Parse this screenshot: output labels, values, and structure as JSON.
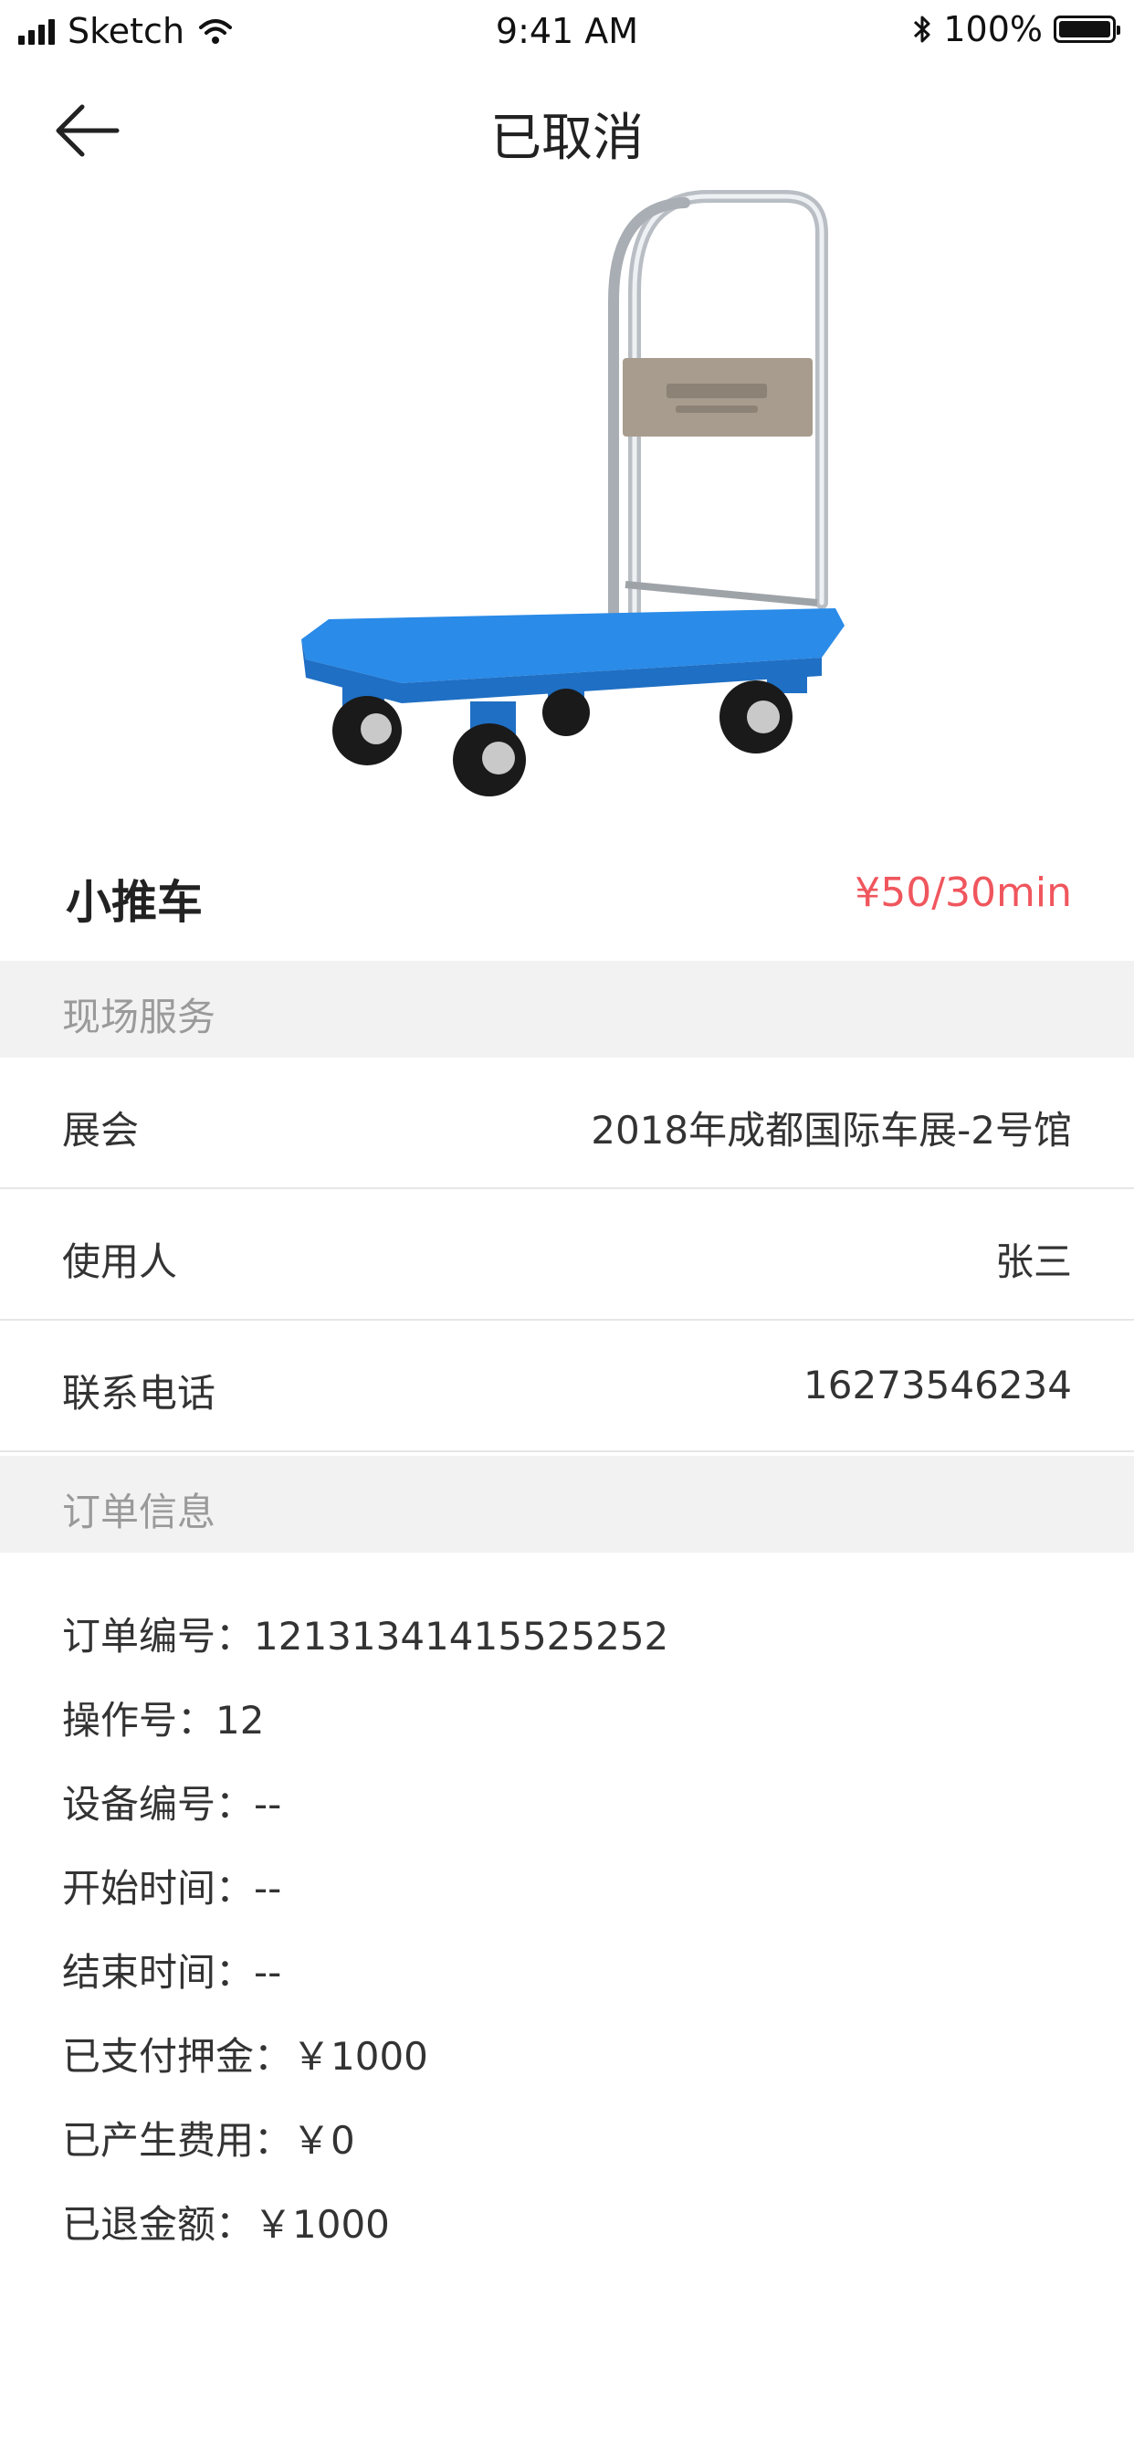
{
  "status_bar": {
    "carrier": "Sketch",
    "time": "9:41 AM",
    "battery": "100%"
  },
  "nav": {
    "title": "已取消"
  },
  "product": {
    "name": "小推车",
    "price": "¥50/30min"
  },
  "onsite_service": {
    "header": "现场服务",
    "rows": [
      {
        "label": "展会",
        "value": "2018年成都国际车展-2号馆"
      },
      {
        "label": "使用人",
        "value": "张三"
      },
      {
        "label": "联系电话",
        "value": "16273546234"
      }
    ]
  },
  "order_info": {
    "header": "订单信息",
    "lines": [
      "订单编号：12131341415525252",
      "操作号：12",
      "设备编号：--",
      "开始时间：--",
      "结束时间：--",
      "已支付押金：￥1000",
      "已产生费用：￥0",
      "已退金额：￥1000"
    ]
  },
  "colors": {
    "price": "#f0565d",
    "section_bg": "#f2f2f2",
    "cart_blue": "#2a8be8"
  }
}
